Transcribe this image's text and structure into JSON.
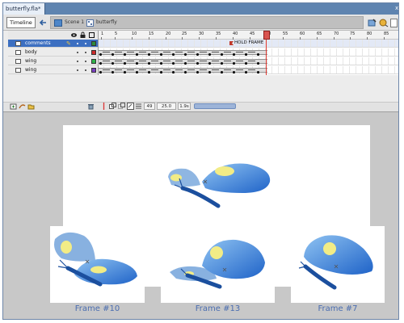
{
  "document_tab": {
    "title": "butterfly.fla*",
    "close_label": "x"
  },
  "toolbar": {
    "timeline_button": "Timeline",
    "scene_label": "Scene 1",
    "symbol_label": "butterfly"
  },
  "timeline": {
    "ruler_labels": [
      "1",
      "5",
      "10",
      "15",
      "20",
      "25",
      "30",
      "35",
      "40",
      "45",
      "50",
      "55",
      "60",
      "65",
      "70",
      "75",
      "80",
      "85"
    ],
    "layers": [
      {
        "name": "comments",
        "selected": true,
        "color": "#2e8b3b"
      },
      {
        "name": "body",
        "selected": false,
        "color": "#cc2a2a"
      },
      {
        "name": "wing",
        "selected": false,
        "color": "#2fb34a"
      },
      {
        "name": "wing",
        "selected": false,
        "color": "#7a3fc0"
      }
    ],
    "frame_label": "HOLD FRAME",
    "current_frame": "49",
    "frame_rate": "25.0 fps",
    "elapsed_time": "1.9s"
  },
  "captions": {
    "frame_10": "Frame #10",
    "frame_13": "Frame #13",
    "frame_7": "Frame #7"
  },
  "colors": {
    "accent": "#3c6fc1",
    "caption": "#4a6db0",
    "wing_blue": "#3f86de",
    "wing_spot": "#f2ec86"
  }
}
